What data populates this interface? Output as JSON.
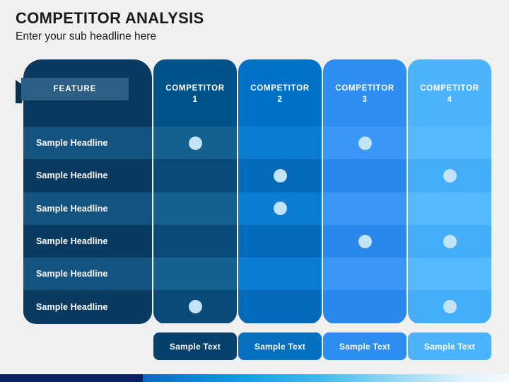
{
  "header": {
    "title": "COMPETITOR ANALYSIS",
    "subtitle": "Enter your sub headline here"
  },
  "feature_panel": {
    "ribbon_label": "FEATURE",
    "rows": [
      {
        "label": "Sample Headline"
      },
      {
        "label": "Sample Headline"
      },
      {
        "label": "Sample Headline"
      },
      {
        "label": "Sample Headline"
      },
      {
        "label": "Sample Headline"
      },
      {
        "label": "Sample Headline"
      }
    ]
  },
  "columns": [
    {
      "header_line1": "COMPETITOR",
      "header_line2": "1",
      "footer_label": "Sample Text",
      "header_color": "#005388",
      "row_color_odd": "#14608f",
      "row_color_even": "#0a4a78",
      "footer_color": "#06416d",
      "marks": [
        true,
        false,
        false,
        false,
        false,
        true
      ]
    },
    {
      "header_line1": "COMPETITOR",
      "header_line2": "2",
      "footer_label": "Sample Text",
      "header_color": "#0072c6",
      "row_color_odd": "#0c7cd0",
      "row_color_even": "#0569ba",
      "footer_color": "#0670bf",
      "marks": [
        false,
        true,
        true,
        false,
        false,
        false
      ]
    },
    {
      "header_line1": "COMPETITOR",
      "header_line2": "3",
      "footer_label": "Sample Text",
      "header_color": "#2f8ff0",
      "row_color_odd": "#3b97f5",
      "row_color_even": "#2a88ec",
      "footer_color": "#2e8ef0",
      "marks": [
        true,
        false,
        false,
        true,
        false,
        false
      ]
    },
    {
      "header_line1": "COMPETITOR",
      "header_line2": "4",
      "footer_label": "Sample Text",
      "header_color": "#4db4fc",
      "row_color_odd": "#57b9fd",
      "row_color_even": "#45aef9",
      "footer_color": "#4db4fc",
      "marks": [
        false,
        true,
        false,
        true,
        false,
        true
      ]
    }
  ],
  "theme": {
    "background": "#f0f0f0",
    "feature_panel_color": "#0a3a60",
    "feature_row_odd": "#14537f",
    "feature_row_even": "#0a3a60",
    "ribbon_color": "#2d5f84",
    "dot_color": "#c3e3f9",
    "bottom_bar_solid": "#0b2265"
  }
}
